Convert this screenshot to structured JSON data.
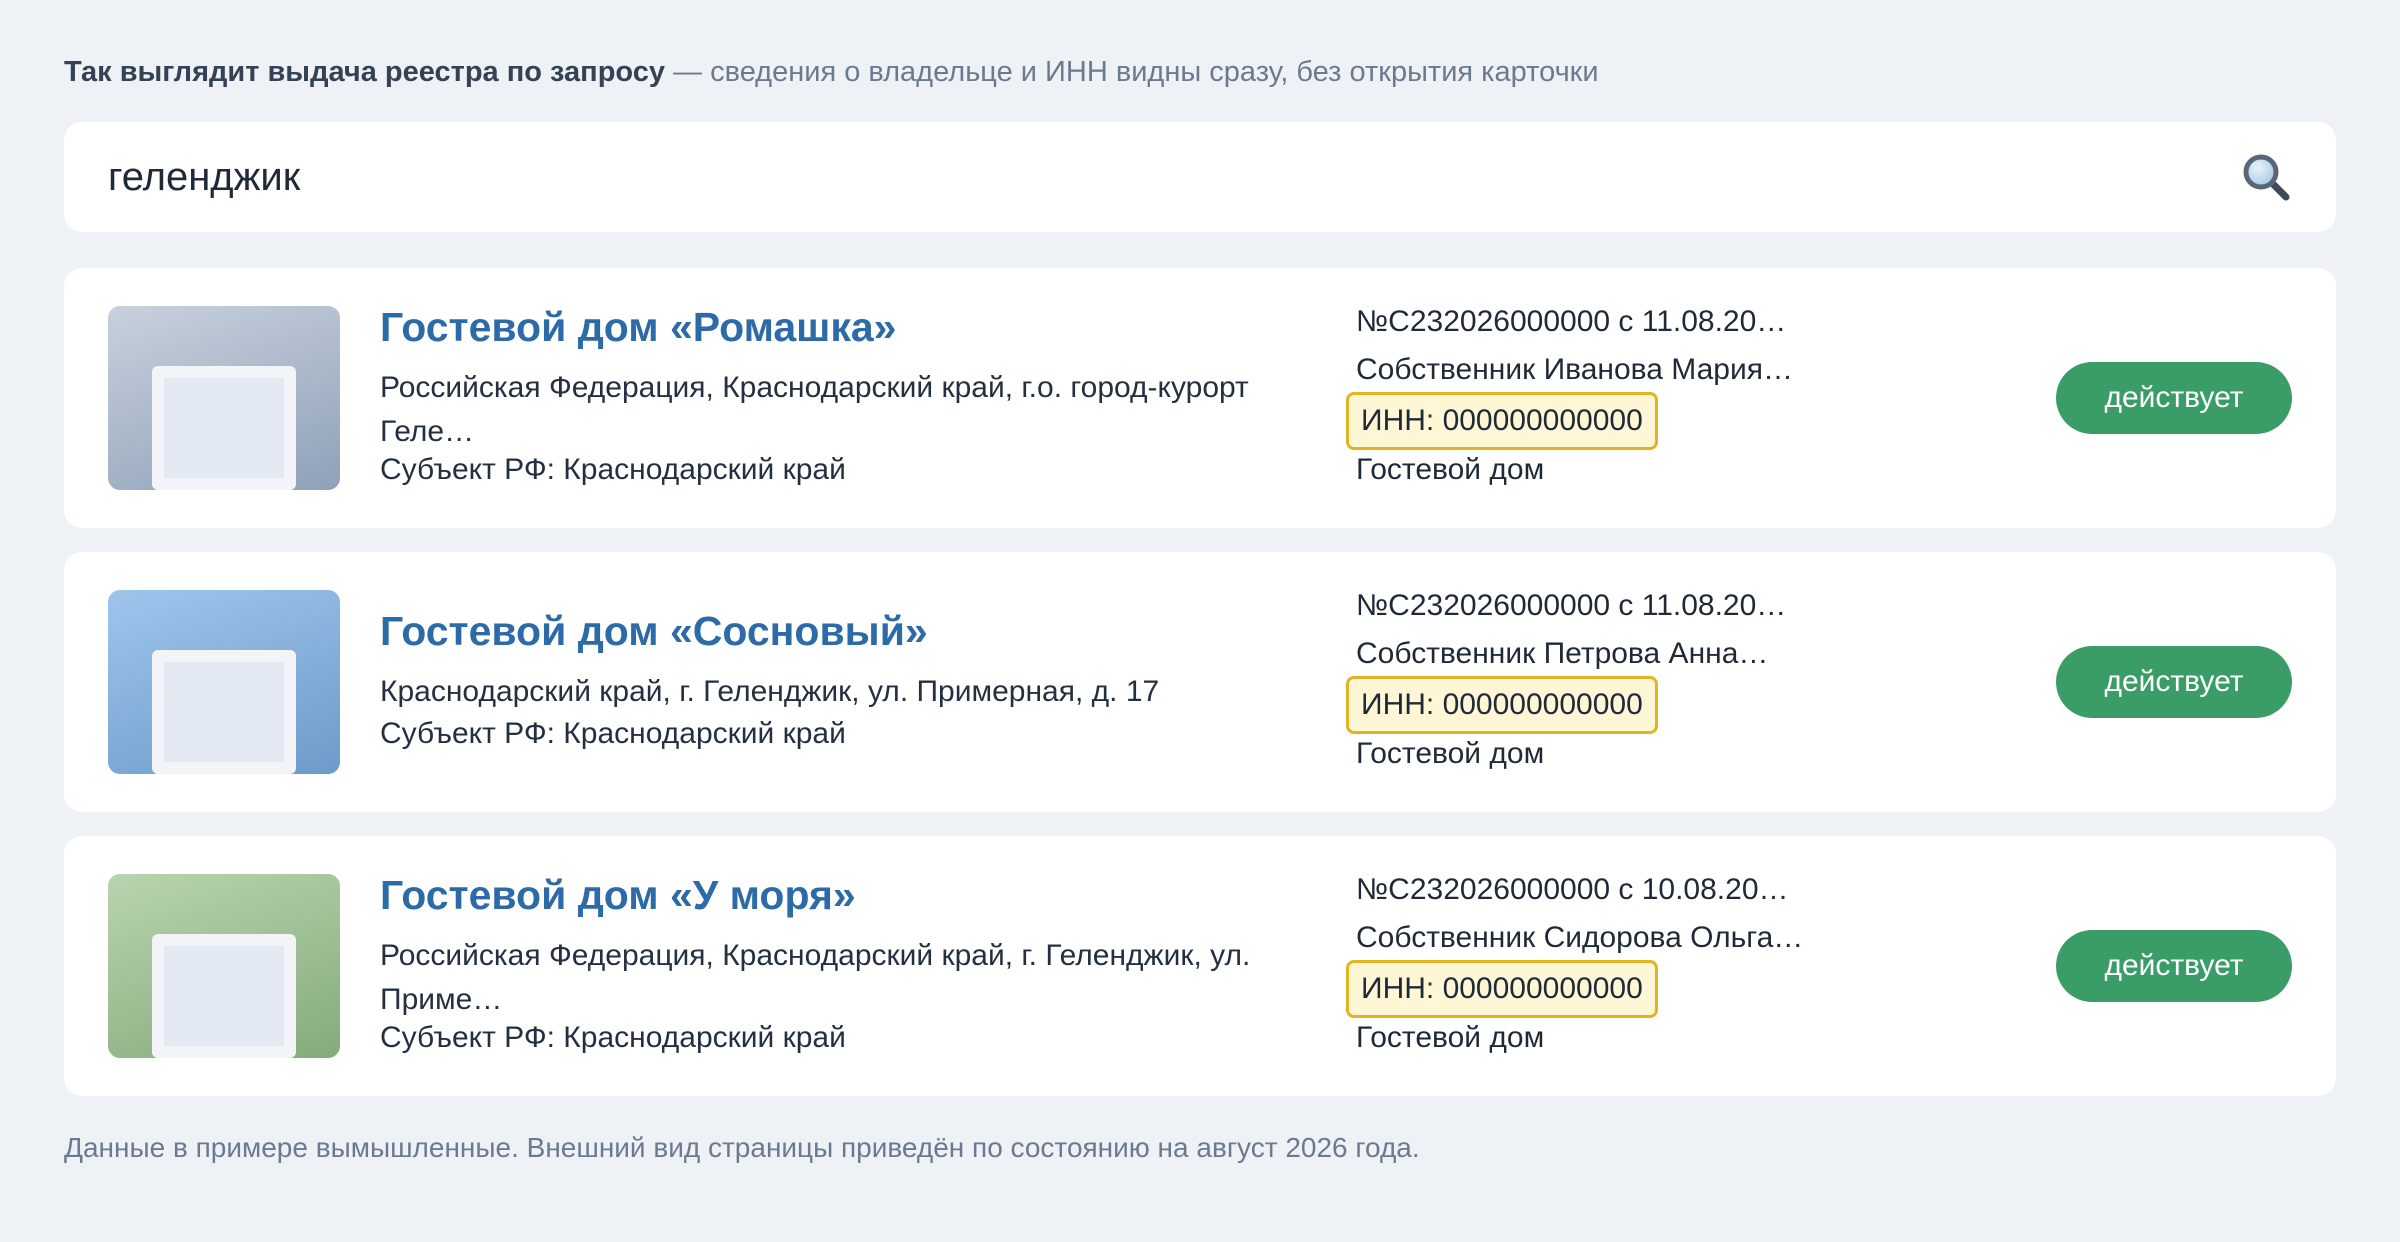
{
  "intro": {
    "lead": "Так выглядит выдача реестра по запросу",
    "rest": " — сведения о владельце и ИНН видны сразу, без открытия карточки"
  },
  "search": {
    "value": "геленджик",
    "icon": "magnifier-icon"
  },
  "results": [
    {
      "title": "Гостевой дом «Ромашка»",
      "address_line1": "Российская Федерация, Краснодарский край, г.о. город-курорт",
      "address_line2": "Геле…",
      "region": "Субъект РФ: Краснодарский край",
      "registry": "№С232026000000 с 11.08.20…",
      "owner": "Собственник Иванова Мария…",
      "inn": "ИНН: 000000000000",
      "kind": "Гостевой дом",
      "status": "действует",
      "thumb_colors": [
        "#c8d1dd",
        "#8fa1b8"
      ]
    },
    {
      "title": "Гостевой дом «Сосновый»",
      "address_line1": "Краснодарский край, г. Геленджик, ул. Примерная, д. 17",
      "address_line2": "",
      "region": "Субъект РФ: Краснодарский край",
      "registry": "№С232026000000 с 11.08.20…",
      "owner": "Собственник Петрова Анна…",
      "inn": "ИНН: 000000000000",
      "kind": "Гостевой дом",
      "status": "действует",
      "thumb_colors": [
        "#9ec5ec",
        "#6d9bc9"
      ]
    },
    {
      "title": "Гостевой дом «У моря»",
      "address_line1": "Российская Федерация, Краснодарский край, г. Геленджик, ул.",
      "address_line2": "Приме…",
      "region": "Субъект РФ: Краснодарский край",
      "registry": "№С232026000000 с 10.08.20…",
      "owner": "Собственник Сидорова Ольга…",
      "inn": "ИНН: 000000000000",
      "kind": "Гостевой дом",
      "status": "действует",
      "thumb_colors": [
        "#b8d4b0",
        "#85ab7a"
      ]
    }
  ],
  "footnote": "Данные в примере вымышленные. Внешний вид страницы приведён по состоянию на август 2026 года.",
  "colors": {
    "accent_title": "#2d6aa8",
    "status_green": "#3a9c67",
    "inn_highlight_border": "#e0b422",
    "inn_highlight_fill": "#fef6d4",
    "background": "#eef2f7"
  }
}
